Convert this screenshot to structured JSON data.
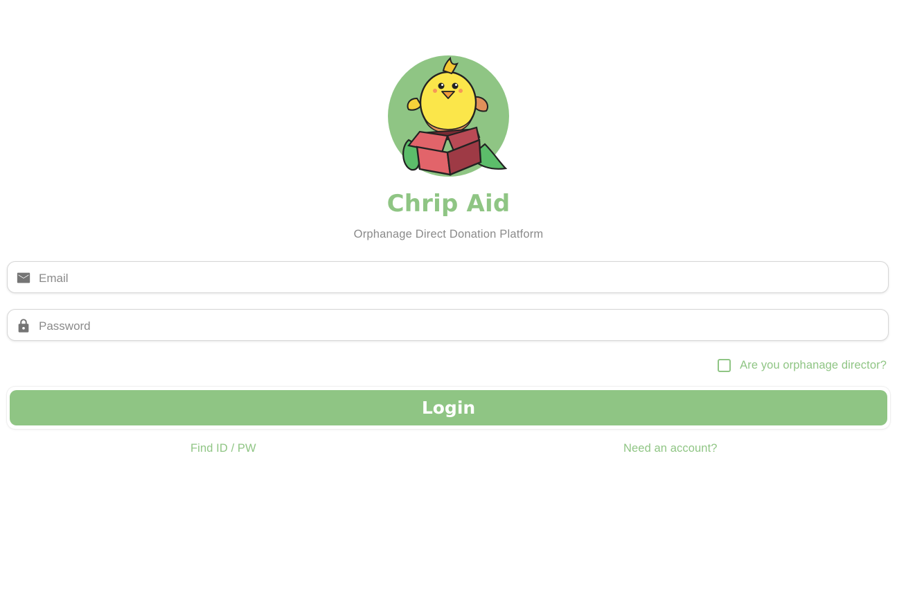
{
  "app": {
    "title": "Chrip Aid",
    "subtitle": "Orphanage Direct Donation Platform",
    "logo_icon": "chick-in-box-logo"
  },
  "form": {
    "email": {
      "placeholder": "Email",
      "value": "",
      "icon": "mail-icon"
    },
    "password": {
      "placeholder": "Password",
      "value": "",
      "icon": "lock-icon"
    },
    "director_checkbox": {
      "label": "Are you orphanage director?",
      "checked": false
    },
    "login_label": "Login"
  },
  "links": {
    "find_id_pw": "Find ID / PW",
    "signup": "Need an account?"
  },
  "colors": {
    "accent": "#8fc584",
    "subtitle": "#8a8a8a",
    "icon": "#757575"
  }
}
